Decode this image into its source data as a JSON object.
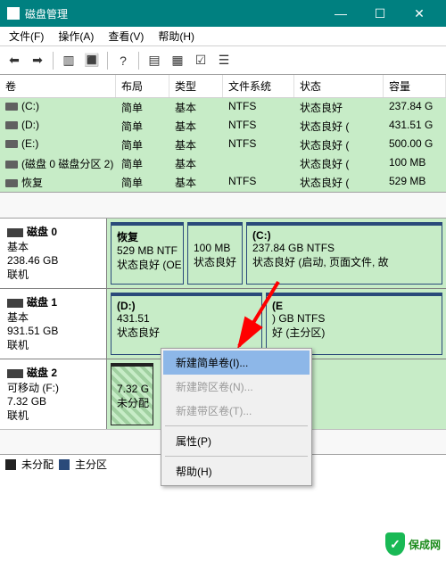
{
  "window": {
    "title": "磁盘管理"
  },
  "win_btn": {
    "min": "—",
    "max": "☐",
    "close": "✕"
  },
  "menu": {
    "file": "文件(F)",
    "action": "操作(A)",
    "view": "查看(V)",
    "help": "帮助(H)"
  },
  "tb": {
    "back": "⬅",
    "fwd": "➡",
    "p": "▥",
    "r": "🔳",
    "h": "?",
    "s": "▤",
    "d": "▦",
    "chk": "☑",
    "l": "☰"
  },
  "cols": {
    "vol": "卷",
    "layout": "布局",
    "type": "类型",
    "fs": "文件系统",
    "status": "状态",
    "cap": "容量"
  },
  "rows": [
    {
      "v": "(C:)",
      "l": "简单",
      "t": "基本",
      "fs": "NTFS",
      "s": "状态良好",
      "c": "237.84 G"
    },
    {
      "v": "(D:)",
      "l": "简单",
      "t": "基本",
      "fs": "NTFS",
      "s": "状态良好 (",
      "c": "431.51 G"
    },
    {
      "v": "(E:)",
      "l": "简单",
      "t": "基本",
      "fs": "NTFS",
      "s": "状态良好 (",
      "c": "500.00 G"
    },
    {
      "v": "(磁盘 0 磁盘分区 2)",
      "l": "简单",
      "t": "基本",
      "fs": "",
      "s": "状态良好 (",
      "c": "100 MB"
    },
    {
      "v": "恢复",
      "l": "简单",
      "t": "基本",
      "fs": "NTFS",
      "s": "状态良好 (",
      "c": "529 MB"
    }
  ],
  "disk0": {
    "name": "磁盘 0",
    "type": "基本",
    "size": "238.46 GB",
    "status": "联机",
    "p1": {
      "name": "恢复",
      "size": "529 MB NTF",
      "st": "状态良好 (OE"
    },
    "p2": {
      "size": "100 MB",
      "st": "状态良好"
    },
    "p3": {
      "name": "(C:)",
      "size": "237.84 GB NTFS",
      "st": "状态良好 (启动, 页面文件, 故"
    }
  },
  "disk1": {
    "name": "磁盘 1",
    "type": "基本",
    "size": "931.51 GB",
    "status": "联机",
    "p1": {
      "name": "(D:)",
      "size": "431.51",
      "st": "状态良好"
    },
    "p2": {
      "name": "(E",
      "size": ") GB NTFS",
      "st": "好 (主分区)"
    }
  },
  "disk2": {
    "name": "磁盘 2",
    "type": "可移动 (F:)",
    "size": "7.32 GB",
    "status": "联机",
    "p1": {
      "size": "7.32 G",
      "st": "未分配"
    }
  },
  "legend": {
    "un": "未分配",
    "pri": "主分区"
  },
  "ctx": {
    "i1": "新建简单卷(I)...",
    "i2": "新建跨区卷(N)...",
    "i3": "新建带区卷(T)...",
    "i4": "属性(P)",
    "i5": "帮助(H)"
  },
  "watermark": "保成网",
  "watermark_check": "✓"
}
